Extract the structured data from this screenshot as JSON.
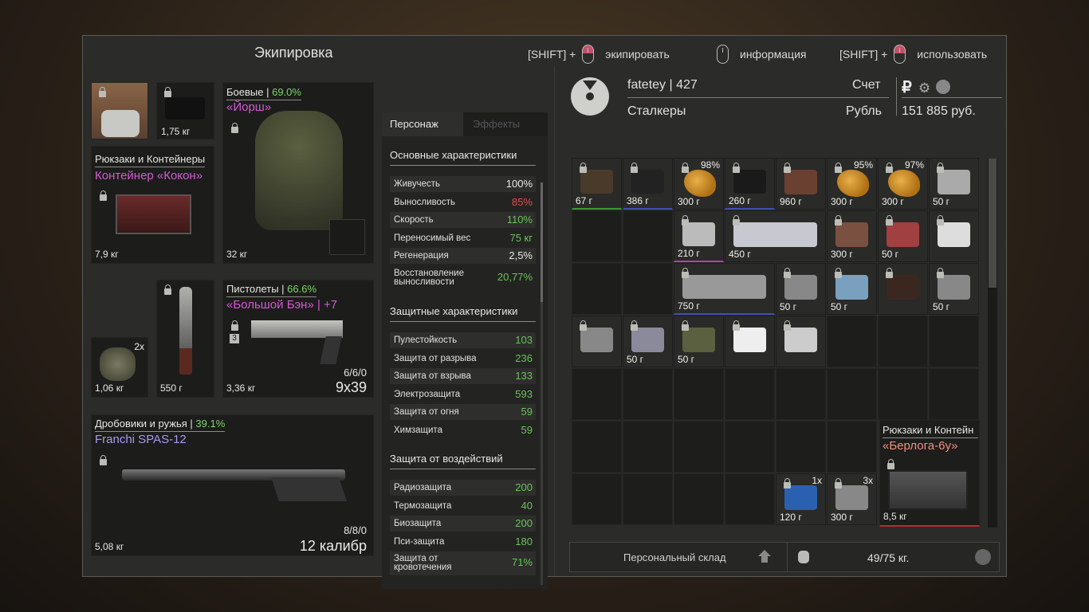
{
  "window": {
    "title": "Экипировка"
  },
  "hints": [
    {
      "prefix": "[SHIFT] +",
      "label": "экипировать"
    },
    {
      "prefix": "",
      "label": "информация"
    },
    {
      "prefix": "[SHIFT] +",
      "label": "использовать"
    }
  ],
  "equipment": {
    "detector_weight": "1,75 кг",
    "backpack": {
      "category": "Рюкзаки и Контейнеры",
      "name": "Контейнер «Кокон»",
      "weight": "7,9 кг"
    },
    "armor": {
      "category": "Боевые",
      "pct": "69.0%",
      "name": "«Йорш»",
      "weight": "32 кг"
    },
    "grenade": {
      "count": "2x",
      "weight": "1,06 кг"
    },
    "knife": {
      "weight": "550 г"
    },
    "pistol": {
      "category": "Пистолеты",
      "pct": "66.6%",
      "name": "«Большой Бэн» | +7",
      "level": "3",
      "weight": "3,36 кг",
      "ammo": "6/6/0",
      "caliber": "9x39"
    },
    "shotgun": {
      "category": "Дробовики и ружья",
      "pct": "39.1%",
      "name": "Franchi SPAS-12",
      "weight": "5,08 кг",
      "ammo": "8/8/0",
      "caliber": "12 калибр"
    }
  },
  "tabs": {
    "character": "Персонаж",
    "effects": "Эффекты"
  },
  "stats": {
    "main_title": "Основные характеристики",
    "main": [
      {
        "label": "Живучесть",
        "value": "100%",
        "color": "w"
      },
      {
        "label": "Выносливость",
        "value": "85%",
        "color": "rd"
      },
      {
        "label": "Скорость",
        "value": "110%",
        "color": "g"
      },
      {
        "label": "Переносимый вес",
        "value": "75 кг",
        "color": "g"
      },
      {
        "label": "Регенерация",
        "value": "2,5%",
        "color": "w"
      },
      {
        "label": "Восстановление выносливости",
        "value": "20,77%",
        "color": "g"
      }
    ],
    "protect_title": "Защитные характеристики",
    "protect": [
      {
        "label": "Пулестойкость",
        "value": "103"
      },
      {
        "label": "Защита от разрыва",
        "value": "236"
      },
      {
        "label": "Защита от взрыва",
        "value": "133"
      },
      {
        "label": "Электрозащита",
        "value": "593"
      },
      {
        "label": "Защита от огня",
        "value": "59"
      },
      {
        "label": "Химзащита",
        "value": "59"
      }
    ],
    "impact_title": "Защита от воздействий",
    "impact": [
      {
        "label": "Радиозащита",
        "value": "200"
      },
      {
        "label": "Термозащита",
        "value": "40"
      },
      {
        "label": "Биозащита",
        "value": "200"
      },
      {
        "label": "Пси-защита",
        "value": "180"
      },
      {
        "label": "Защита от кровотечения",
        "value": "71%"
      }
    ]
  },
  "player": {
    "name": "fatetey",
    "level": "427",
    "account_label": "Счет",
    "faction": "Сталкеры",
    "currency_label": "Рубль",
    "balance": "151 885 руб."
  },
  "inventory": [
    {
      "weight": "67 г",
      "pct": ""
    },
    {
      "weight": "386 г",
      "pct": ""
    },
    {
      "weight": "300 г",
      "pct": "98%"
    },
    {
      "weight": "260 г",
      "pct": ""
    },
    {
      "weight": "960 г",
      "pct": ""
    },
    {
      "weight": "300 г",
      "pct": "95%"
    },
    {
      "weight": "300 г",
      "pct": "97%"
    },
    {
      "weight": "50 г",
      "pct": ""
    },
    {
      "weight": "210 г"
    },
    {
      "weight": "450 г"
    },
    {
      "weight": "300 г"
    },
    {
      "weight": "50 г"
    },
    {
      "weight": ""
    },
    {
      "weight": "750 г"
    },
    {
      "weight": "50 г"
    },
    {
      "weight": "50 г"
    },
    {
      "weight": ""
    },
    {
      "weight": "50 г"
    },
    {
      "weight": ""
    },
    {
      "weight": "50 г"
    },
    {
      "weight": "50 г"
    },
    {
      "weight": ""
    },
    {
      "weight": ""
    },
    {
      "weight": "120 г",
      "count": "1x"
    },
    {
      "weight": "300 г",
      "count": "3x"
    }
  ],
  "inv_backpack": {
    "category": "Рюкзаки и Контейн",
    "name": "«Берлога-6у»",
    "weight": "8,5 кг"
  },
  "footer": {
    "storage": "Персональный склад",
    "weight": "49/75 кг."
  }
}
